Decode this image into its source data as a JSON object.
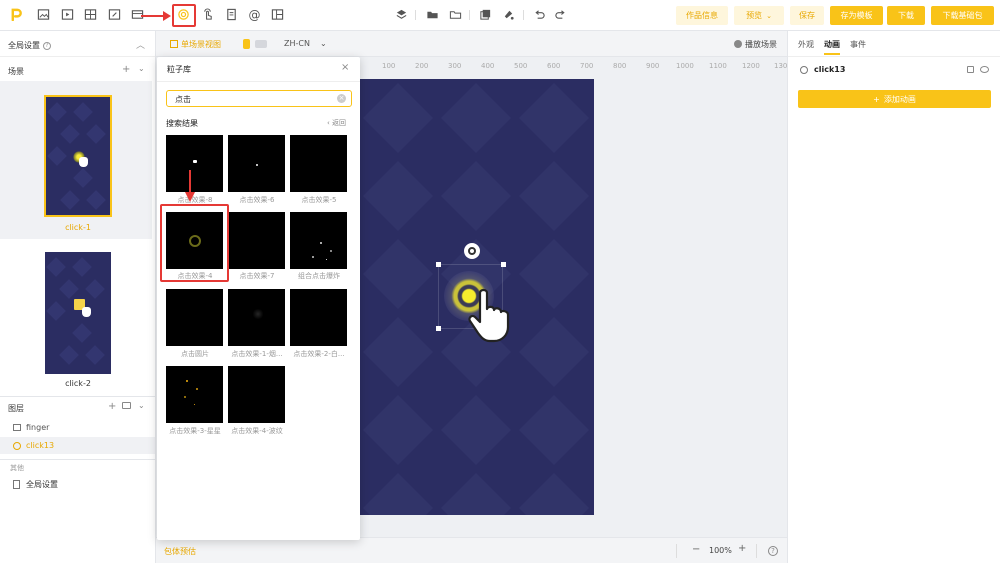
{
  "colors": {
    "accent": "#f9c318",
    "scene_bg": "#2b2d62",
    "highlight": "#e53935"
  },
  "toolbar": {
    "left_icons": [
      "logo-icon",
      "image-icon",
      "video-icon",
      "grid-icon",
      "shape-icon",
      "frame-icon",
      "particle-icon",
      "gesture-icon",
      "document-icon",
      "at-icon",
      "layout-icon"
    ],
    "center_icons": [
      "layers-icon",
      "folder-icon",
      "folder-open-icon",
      "copy-icon",
      "paint-icon",
      "undo-icon",
      "redo-icon"
    ],
    "info_label": "作品信息",
    "preview_label": "预览",
    "save_label": "保存",
    "save_template_label": "存为模板",
    "download_label": "下载",
    "download_base_label": "下载基础包"
  },
  "left": {
    "global_settings": "全局设置",
    "scenes_title": "场景",
    "scenes": [
      {
        "label": "click-1"
      },
      {
        "label": "click-2"
      }
    ],
    "layers_title": "图层",
    "layers": [
      {
        "label": "finger"
      },
      {
        "label": "click13"
      }
    ],
    "other_title": "其他",
    "other_items": [
      {
        "label": "全局设置"
      }
    ]
  },
  "canvas": {
    "view_mode_label": "单场景视图",
    "language": "ZH-CN",
    "play_scene_label": "播放场景",
    "ruler_ticks": [
      "100",
      "200",
      "300",
      "400",
      "500",
      "600",
      "700",
      "800",
      "900",
      "1000",
      "1100",
      "1200",
      "130"
    ],
    "zoom": "100%",
    "bottom_left_label": "包体预估"
  },
  "right": {
    "tabs": [
      "外观",
      "动画",
      "事件"
    ],
    "active_tab": "动画",
    "object_name": "click13",
    "add_animation_label": "添加动画"
  },
  "popup": {
    "title": "粒子库",
    "search_value": "点击",
    "results_label": "搜索结果",
    "back_label": "返回",
    "items": [
      {
        "label": "点击效果-8"
      },
      {
        "label": "点击效果-6"
      },
      {
        "label": "点击效果-5"
      },
      {
        "label": "点击效果-4"
      },
      {
        "label": "点击效果-7"
      },
      {
        "label": "组合点击爆炸"
      },
      {
        "label": "点击圆片"
      },
      {
        "label": "点击效果-1-烟..."
      },
      {
        "label": "点击效果-2-白..."
      },
      {
        "label": "点击效果-3-星星"
      },
      {
        "label": "点击效果-4-波纹"
      }
    ]
  }
}
